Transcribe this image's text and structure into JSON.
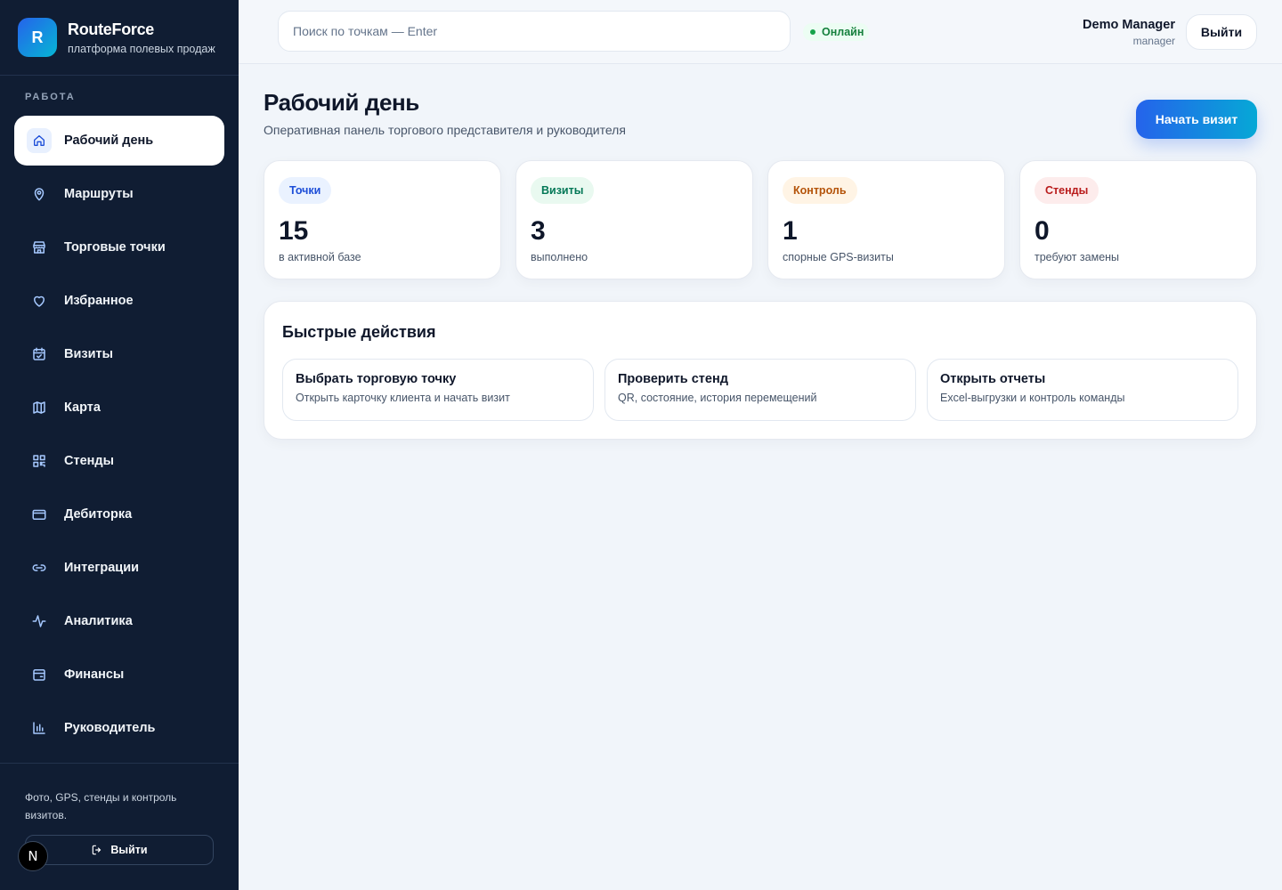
{
  "brand": {
    "logo_letter": "R",
    "name": "RouteForce",
    "subtitle": "платформа полевых продаж"
  },
  "sidebar": {
    "section_label": "РАБОТА",
    "items": [
      {
        "label": "Рабочий день",
        "icon": "home-icon",
        "active": true
      },
      {
        "label": "Маршруты",
        "icon": "map-pin-icon"
      },
      {
        "label": "Торговые точки",
        "icon": "store-icon"
      },
      {
        "label": "Избранное",
        "icon": "heart-icon"
      },
      {
        "label": "Визиты",
        "icon": "calendar-check-icon"
      },
      {
        "label": "Карта",
        "icon": "map-icon"
      },
      {
        "label": "Стенды",
        "icon": "qr-code-icon"
      },
      {
        "label": "Дебиторка",
        "icon": "credit-card-icon"
      },
      {
        "label": "Интеграции",
        "icon": "link-icon"
      },
      {
        "label": "Аналитика",
        "icon": "activity-icon"
      },
      {
        "label": "Финансы",
        "icon": "wallet-icon"
      },
      {
        "label": "Руководитель",
        "icon": "bar-chart-icon"
      }
    ],
    "footer_text": "Фото, GPS, стенды и контроль визитов.",
    "logout_label": "Выйти",
    "badge_letter": "N"
  },
  "topbar": {
    "search_placeholder": "Поиск по точкам — Enter",
    "status": "Онлайн",
    "user_name": "Demo Manager",
    "user_role": "manager",
    "logout_label": "Выйти"
  },
  "main": {
    "title": "Рабочий день",
    "subtitle": "Оперативная панель торгового представителя и руководителя",
    "start_visit_label": "Начать визит",
    "stats": [
      {
        "badge": "Точки",
        "value": "15",
        "caption": "в активной базе",
        "badge_bg": "#eaf2ff",
        "badge_color": "#1d4ed8"
      },
      {
        "badge": "Визиты",
        "value": "3",
        "caption": "выполнено",
        "badge_bg": "#e9f9f0",
        "badge_color": "#047857"
      },
      {
        "badge": "Контроль",
        "value": "1",
        "caption": "спорные GPS-визиты",
        "badge_bg": "#fff4e5",
        "badge_color": "#b45309"
      },
      {
        "badge": "Стенды",
        "value": "0",
        "caption": "требуют замены",
        "badge_bg": "#fdecec",
        "badge_color": "#b91c1c"
      }
    ],
    "quick_actions": {
      "title": "Быстрые действия",
      "items": [
        {
          "title": "Выбрать торговую точку",
          "subtitle": "Открыть карточку клиента и начать визит"
        },
        {
          "title": "Проверить стенд",
          "subtitle": "QR, состояние, история перемещений"
        },
        {
          "title": "Открыть отчеты",
          "subtitle": "Excel-выгрузки и контроль команды"
        }
      ]
    }
  }
}
